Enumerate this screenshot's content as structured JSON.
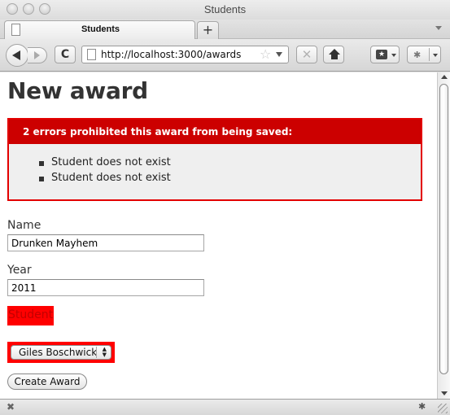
{
  "window": {
    "title": "Students"
  },
  "tabs": [
    {
      "label": "Students",
      "active": true
    }
  ],
  "tabstrip": {
    "new_tab_label": "+"
  },
  "toolbar": {
    "reload_glyph": "C",
    "url": "http://localhost:3000/awards",
    "star_glyph": "☆",
    "stop_glyph": "✕",
    "bookmark_glyph": "★",
    "firebug_glyph": "✱"
  },
  "page": {
    "heading": "New award",
    "error_box": {
      "title": "2 errors prohibited this award from being saved:",
      "errors": [
        "Student does not exist",
        "Student does not exist"
      ],
      "colors": {
        "border": "#e30000",
        "header_bg": "#cc0000",
        "body_bg": "#efefef"
      }
    },
    "form": {
      "name_label": "Name",
      "name_value": "Drunken Mayhem",
      "year_label": "Year",
      "year_value": "2011",
      "student_label": "Student",
      "student_selected": "Giles Boschwick",
      "submit_label": "Create Award",
      "error_highlight_color": "#ff0000"
    }
  },
  "statusbar": {
    "close_glyph": "✖",
    "firebug_glyph": "✱"
  }
}
